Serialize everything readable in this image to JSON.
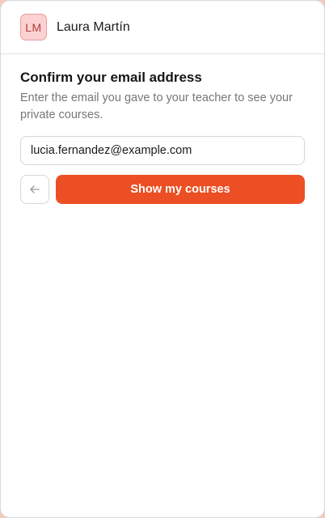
{
  "header": {
    "avatar_initials": "LM",
    "user_name": "Laura Martín"
  },
  "form": {
    "title": "Confirm your email address",
    "subtitle": "Enter the email you gave to your teacher to see your private courses.",
    "email_value": "lucia.fernandez@example.com",
    "back_icon": "arrow-left-icon",
    "submit_label": "Show my courses"
  },
  "colors": {
    "accent": "#eb4f23",
    "avatar_bg": "#fbd1d1",
    "avatar_text": "#b53c3c"
  }
}
